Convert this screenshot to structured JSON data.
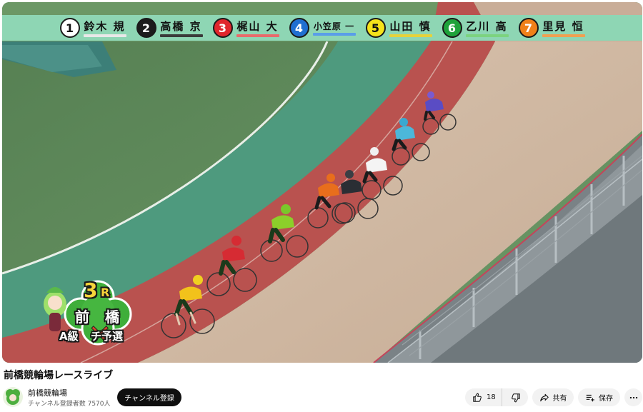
{
  "video": {
    "title": "前橋競輪場レースライブ",
    "overlay": {
      "roster": [
        {
          "number": "1",
          "name": "鈴木 規",
          "bg": "#ffffff",
          "fg": "#111111",
          "underline": "#e8e8e8"
        },
        {
          "number": "2",
          "name": "高橋 京",
          "bg": "#1c1c1c",
          "fg": "#ffffff",
          "underline": "#3a3a3a"
        },
        {
          "number": "3",
          "name": "梶山 大",
          "bg": "#e0262c",
          "fg": "#ffffff",
          "underline": "#e86a6a"
        },
        {
          "number": "4",
          "name": "小笠原 一",
          "bg": "#1f6fd1",
          "fg": "#ffffff",
          "underline": "#5a9ee8"
        },
        {
          "number": "5",
          "name": "山田 慎",
          "bg": "#f6e21a",
          "fg": "#111111",
          "underline": "#e6d23a"
        },
        {
          "number": "6",
          "name": "乙川 高",
          "bg": "#1ea23a",
          "fg": "#ffffff",
          "underline": "#7cd37f"
        },
        {
          "number": "7",
          "name": "里見 恒",
          "bg": "#f08018",
          "fg": "#ffffff",
          "underline": "#f0a050"
        }
      ],
      "race_badge": {
        "race": "3",
        "race_unit": "R",
        "venue_left": "前",
        "venue_right": "橋",
        "class_label": "A級",
        "event_label": "チ予選"
      }
    }
  },
  "channel": {
    "name": "前橋競輪場",
    "subscribers": "チャンネル登録者数 7570人",
    "subscribe_label": "チャンネル登録"
  },
  "actions": {
    "like_count": "18",
    "share_label": "共有",
    "save_label": "保存"
  },
  "icons": {
    "like": "thumbs-up-icon",
    "dislike": "thumbs-down-icon",
    "share": "share-arrow-icon",
    "save": "add-to-playlist-icon",
    "more": "more-horizontal-icon"
  }
}
